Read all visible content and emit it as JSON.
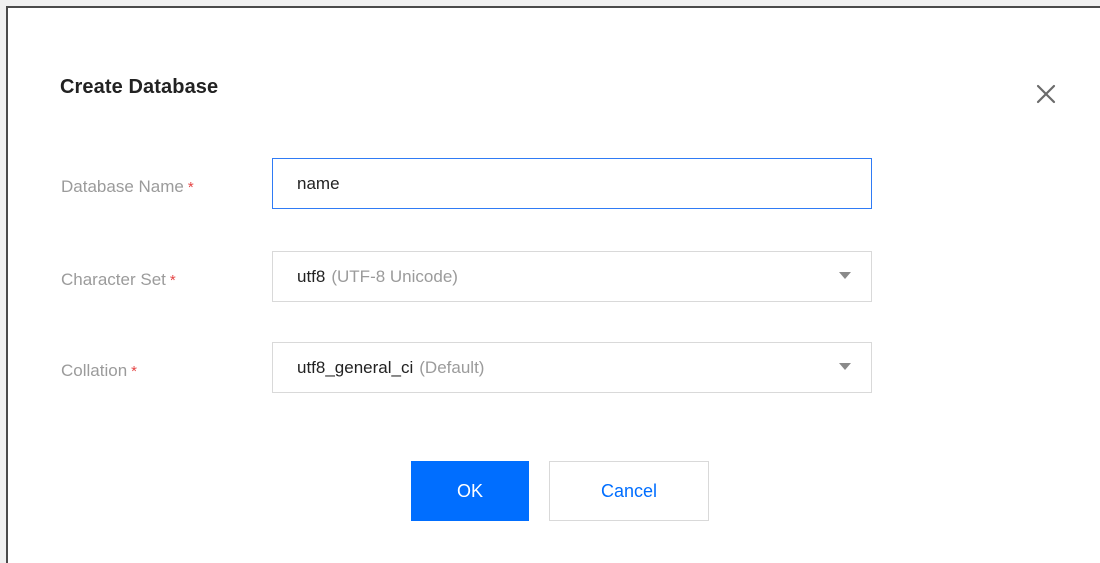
{
  "dialog": {
    "title": "Create Database"
  },
  "form": {
    "database_name": {
      "label": "Database Name",
      "required_mark": "*",
      "value": "name"
    },
    "character_set": {
      "label": "Character Set",
      "required_mark": "*",
      "value": "utf8",
      "hint": "(UTF-8 Unicode)"
    },
    "collation": {
      "label": "Collation",
      "required_mark": "*",
      "value": "utf8_general_ci",
      "hint": "(Default)"
    }
  },
  "buttons": {
    "ok_label": "OK",
    "cancel_label": "Cancel"
  },
  "icons": {
    "close": "close-icon",
    "dropdown": "chevron-down-icon"
  },
  "colors": {
    "primary": "#006eff",
    "required": "#e54545",
    "label": "#9b9b9b",
    "focus_border": "#2f7bf5"
  }
}
